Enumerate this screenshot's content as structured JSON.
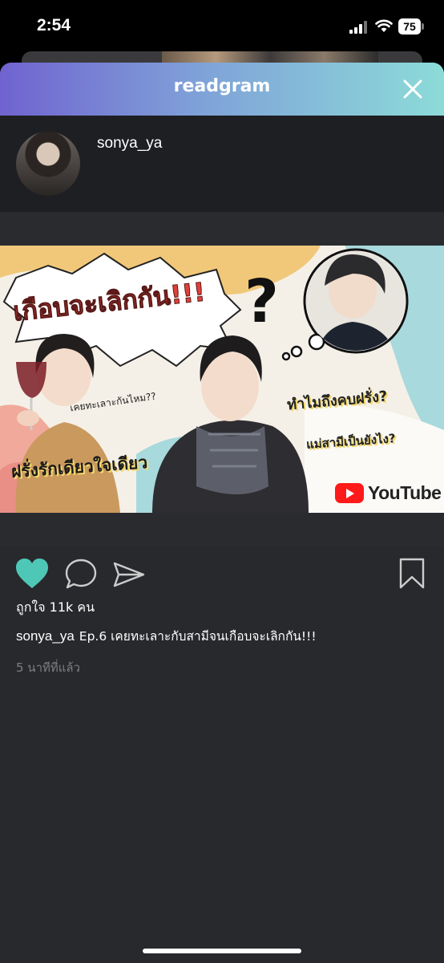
{
  "status_bar": {
    "time": "2:54",
    "battery": "75"
  },
  "modal": {
    "title": "readgram"
  },
  "post": {
    "username": "sonya_ya",
    "image_text": {
      "headline": "เกือบจะเลิกกัน!!!",
      "bubble_sub": "เคยทะเลาะกันไหม??",
      "left_banner": "ฝรั่งรักเดียวใจเดียว",
      "why": "ทำไมถึงคบฝรั่ง?",
      "mom": "แม่สามีเป็นยังไง?",
      "youtube": "YouTube"
    },
    "likes": "ถูกใจ 11k คน",
    "caption_user": "sonya_ya",
    "caption_text": "Ep.6 เคยทะเลาะกับสามีจนเกือบจะเลิกกัน!!!",
    "time_ago": "5 นาทีที่แล้ว"
  },
  "colors": {
    "header_gradient_start": "#7063d0",
    "header_gradient_end": "#8cdbd8",
    "like_heart": "#4fc7b6",
    "modal_bg": "#28292d"
  },
  "icons": [
    "close-icon",
    "heart-icon",
    "comment-icon",
    "send-icon",
    "bookmark-icon",
    "youtube-icon"
  ]
}
